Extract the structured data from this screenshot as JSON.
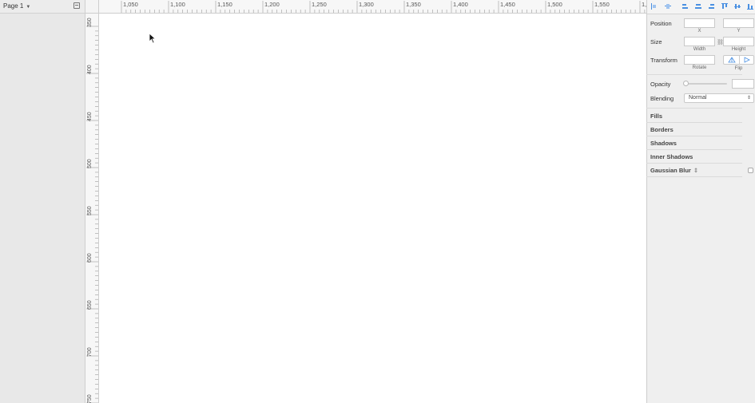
{
  "pages": {
    "current_page": "Page 1"
  },
  "ruler_top": {
    "labels": [
      "1,050",
      "1,100",
      "1,150",
      "1,200",
      "1,250",
      "1,300",
      "1,350",
      "1,400",
      "1,450",
      "1,500",
      "1,550",
      "1,"
    ]
  },
  "ruler_left": {
    "labels": [
      "350",
      "400",
      "450",
      "500",
      "550",
      "600",
      "650",
      "700",
      "750"
    ]
  },
  "inspector": {
    "position": {
      "label": "Position",
      "x_label": "X",
      "y_label": "Y",
      "x_value": "",
      "y_value": ""
    },
    "size": {
      "label": "Size",
      "width_label": "Width",
      "height_label": "Height",
      "width_value": "",
      "height_value": ""
    },
    "transform": {
      "label": "Transform",
      "rotate_label": "Rotate",
      "flip_label": "Flip",
      "rotate_value": ""
    },
    "opacity": {
      "label": "Opacity",
      "value": ""
    },
    "blending": {
      "label": "Blending",
      "value": "Normal"
    },
    "sections": [
      "Fills",
      "Borders",
      "Shadows",
      "Inner Shadows",
      "Gaussian Blur"
    ]
  },
  "colors": {
    "accent": "#4a90e2",
    "canvas": "#ffffff",
    "panel": "#efefef"
  }
}
